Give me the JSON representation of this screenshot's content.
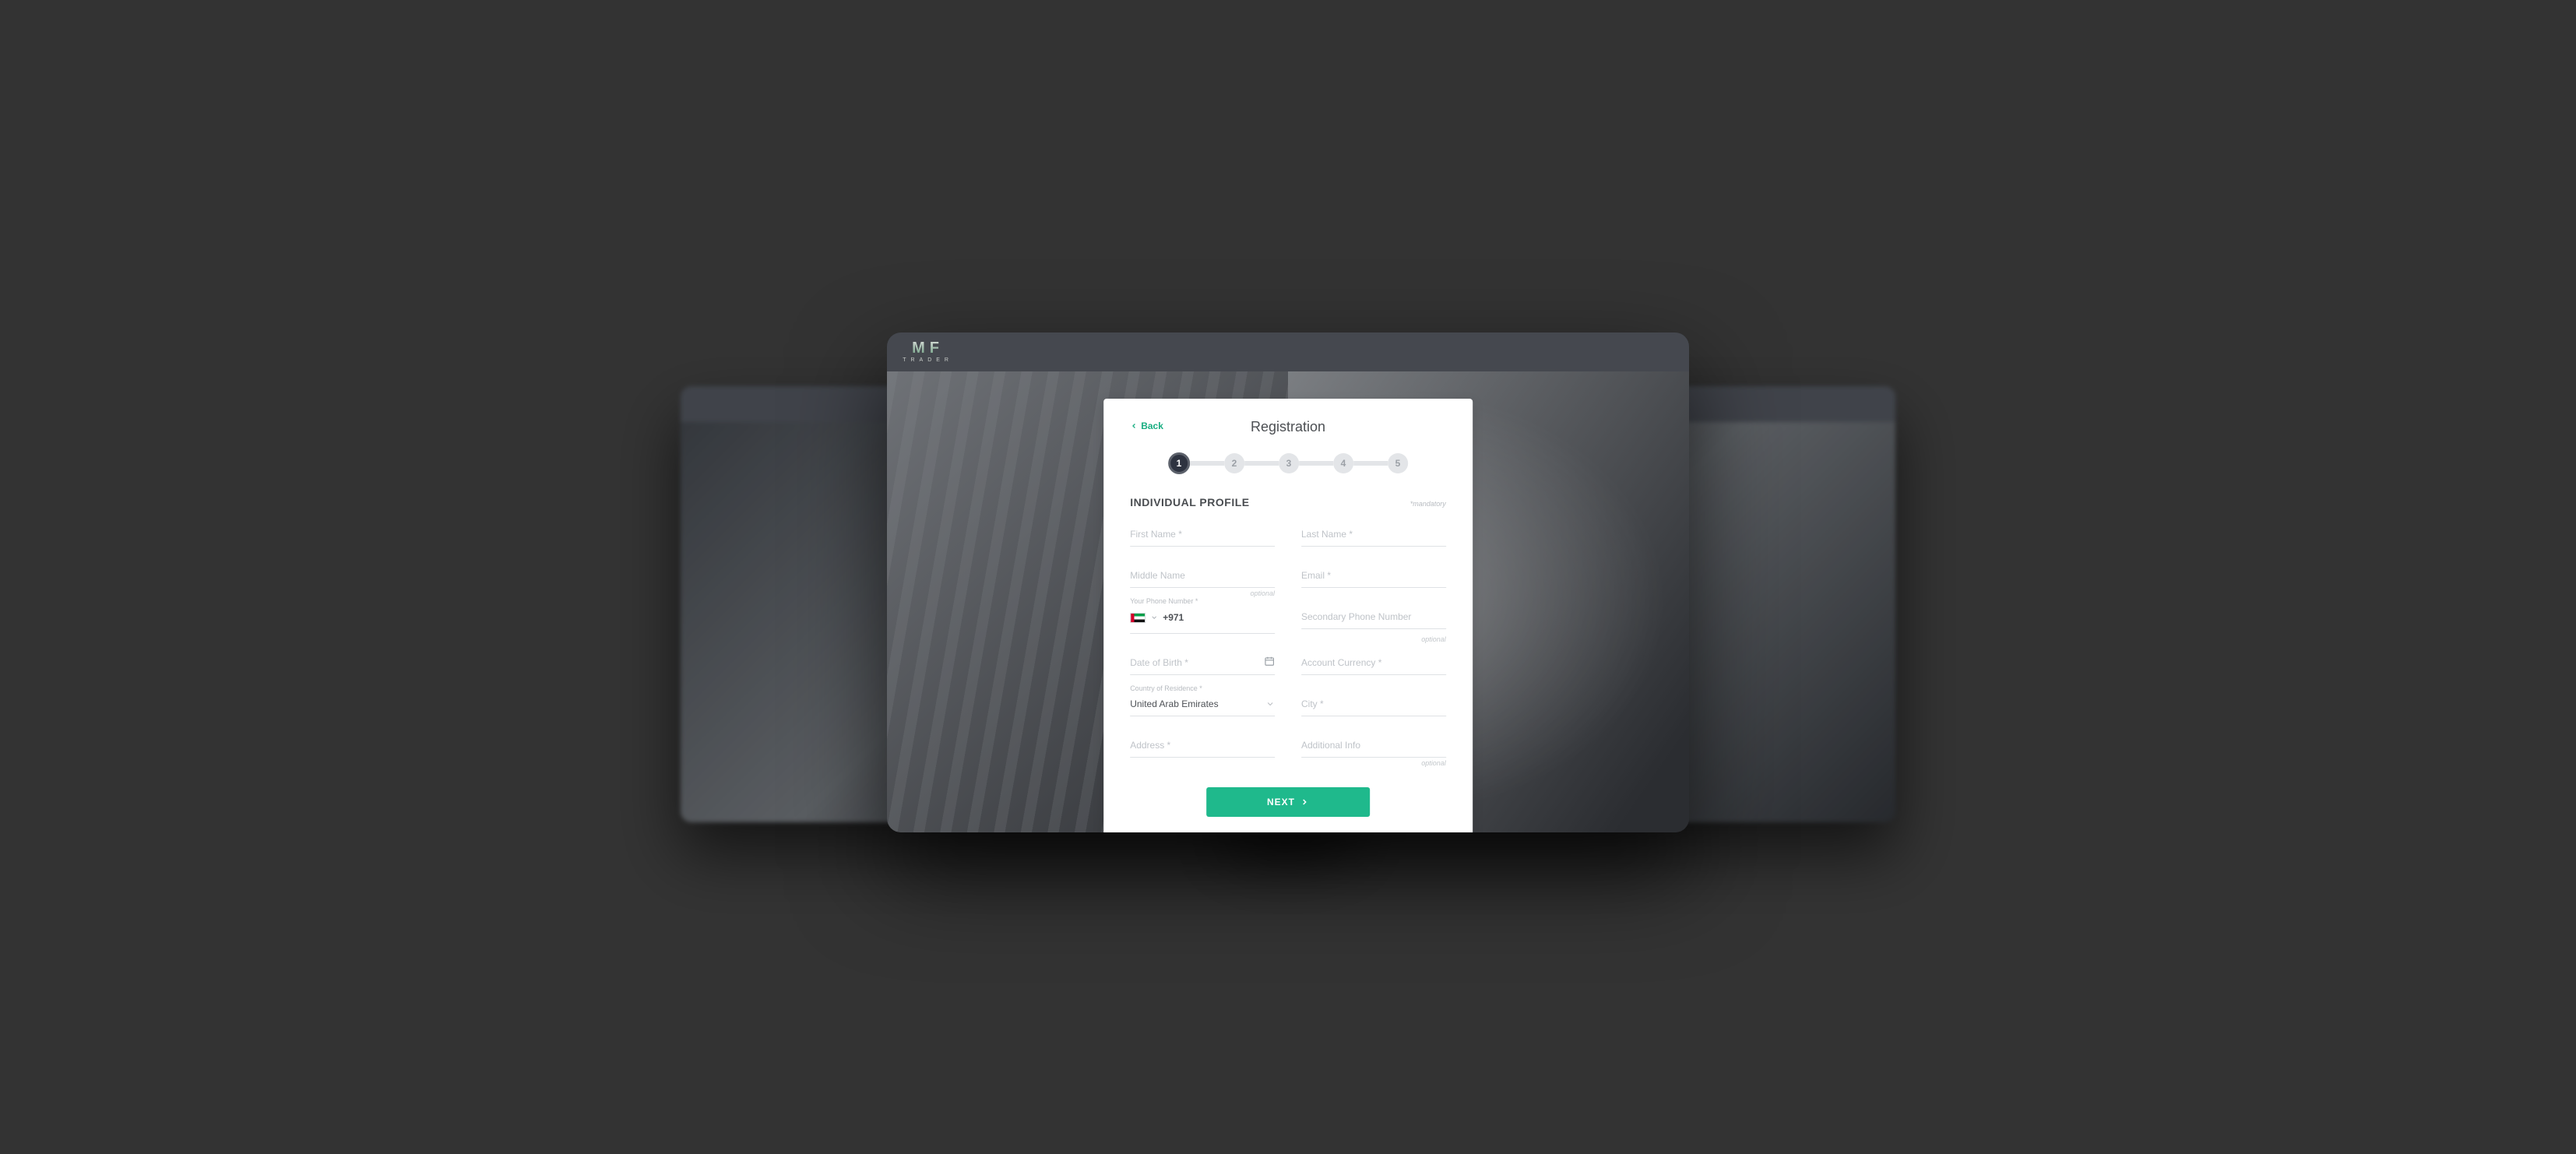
{
  "brand": {
    "mark": "MF",
    "sub": "TRADER"
  },
  "header": {
    "back_label": "Back",
    "title": "Registration"
  },
  "stepper": {
    "steps": [
      "1",
      "2",
      "3",
      "4",
      "5"
    ],
    "active_index": 0
  },
  "section": {
    "title": "INDIVIDUAL PROFILE",
    "mandatory_note": "*mandatory"
  },
  "fields": {
    "first_name": {
      "placeholder": "First Name *"
    },
    "last_name": {
      "placeholder": "Last Name *"
    },
    "middle_name": {
      "placeholder": "Middle Name",
      "hint": "optional"
    },
    "email": {
      "placeholder": "Email *"
    },
    "phone": {
      "label": "Your Phone Number *",
      "dial_code": "+971"
    },
    "sec_phone": {
      "placeholder": "Secondary Phone Number",
      "hint": "optional"
    },
    "dob": {
      "placeholder": "Date of Birth *"
    },
    "currency": {
      "placeholder": "Account Currency *"
    },
    "country": {
      "label": "Country of Residence *",
      "value": "United Arab Emirates"
    },
    "city": {
      "placeholder": "City *"
    },
    "address": {
      "placeholder": "Address *"
    },
    "add_info": {
      "placeholder": "Additional Info",
      "hint": "optional"
    }
  },
  "actions": {
    "next_label": "NEXT"
  },
  "colors": {
    "accent": "#1fb98c",
    "step_active": "#2e3340"
  }
}
